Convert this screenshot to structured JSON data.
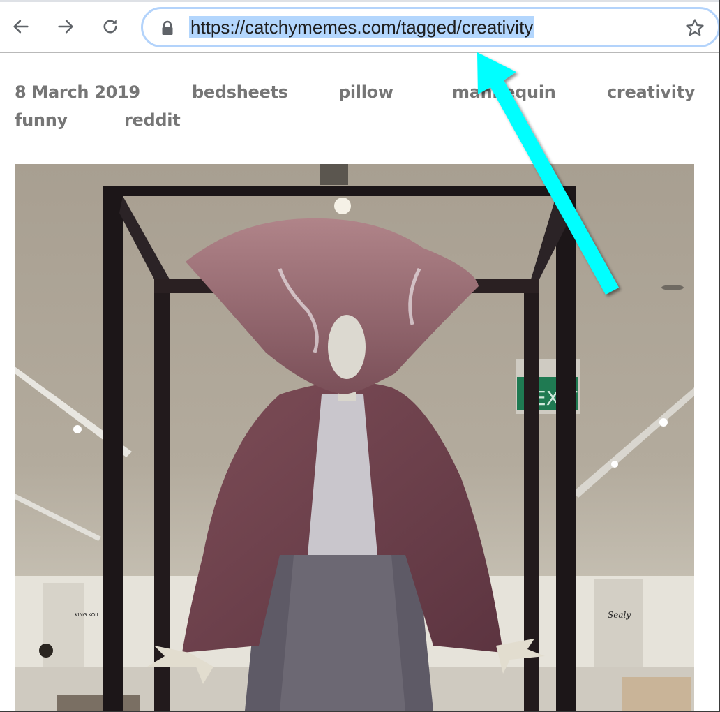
{
  "browser": {
    "nav": {
      "back_icon": "arrow-left-icon",
      "forward_icon": "arrow-right-icon",
      "reload_icon": "reload-icon"
    },
    "omnibox": {
      "security_icon": "lock-icon",
      "url": "https://catchymemes.com/tagged/creativity",
      "url_selected": true,
      "bookmark_icon": "star-icon"
    }
  },
  "post": {
    "date": "8 March 2019",
    "tags": [
      "bedsheets",
      "pillow",
      "mannequin",
      "creativity",
      "funny",
      "reddit"
    ]
  },
  "image": {
    "description": "Mannequin in a store display wearing a pillow on its head and a bedsheet as a shawl, standing inside a black metal frame",
    "signs": {
      "exit": "EXIT",
      "brand_left": "KING KOIL",
      "brand_right": "Sealy"
    }
  },
  "annotation": {
    "type": "arrow",
    "color": "#00ffff",
    "points_to": "url-bar"
  },
  "colors": {
    "selection": "#b3d6fd",
    "omnibox_border": "#b3d3fb",
    "tag_text": "#767676",
    "arrow": "#00ffff"
  }
}
